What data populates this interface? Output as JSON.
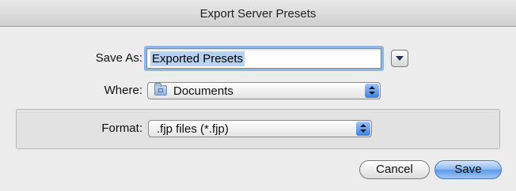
{
  "window": {
    "title": "Export Server Presets"
  },
  "save_as": {
    "label": "Save As:",
    "value": "Exported Presets"
  },
  "where": {
    "label": "Where:",
    "selected": "Documents",
    "icon": "folder-icon"
  },
  "format": {
    "label": "Format:",
    "selected": ".fjp files (*.fjp)"
  },
  "buttons": {
    "cancel": "Cancel",
    "save": "Save"
  },
  "colors": {
    "selection": "#b7d2f1",
    "focus_ring": "#8fb6e8",
    "accent": "#3a7fe0"
  }
}
